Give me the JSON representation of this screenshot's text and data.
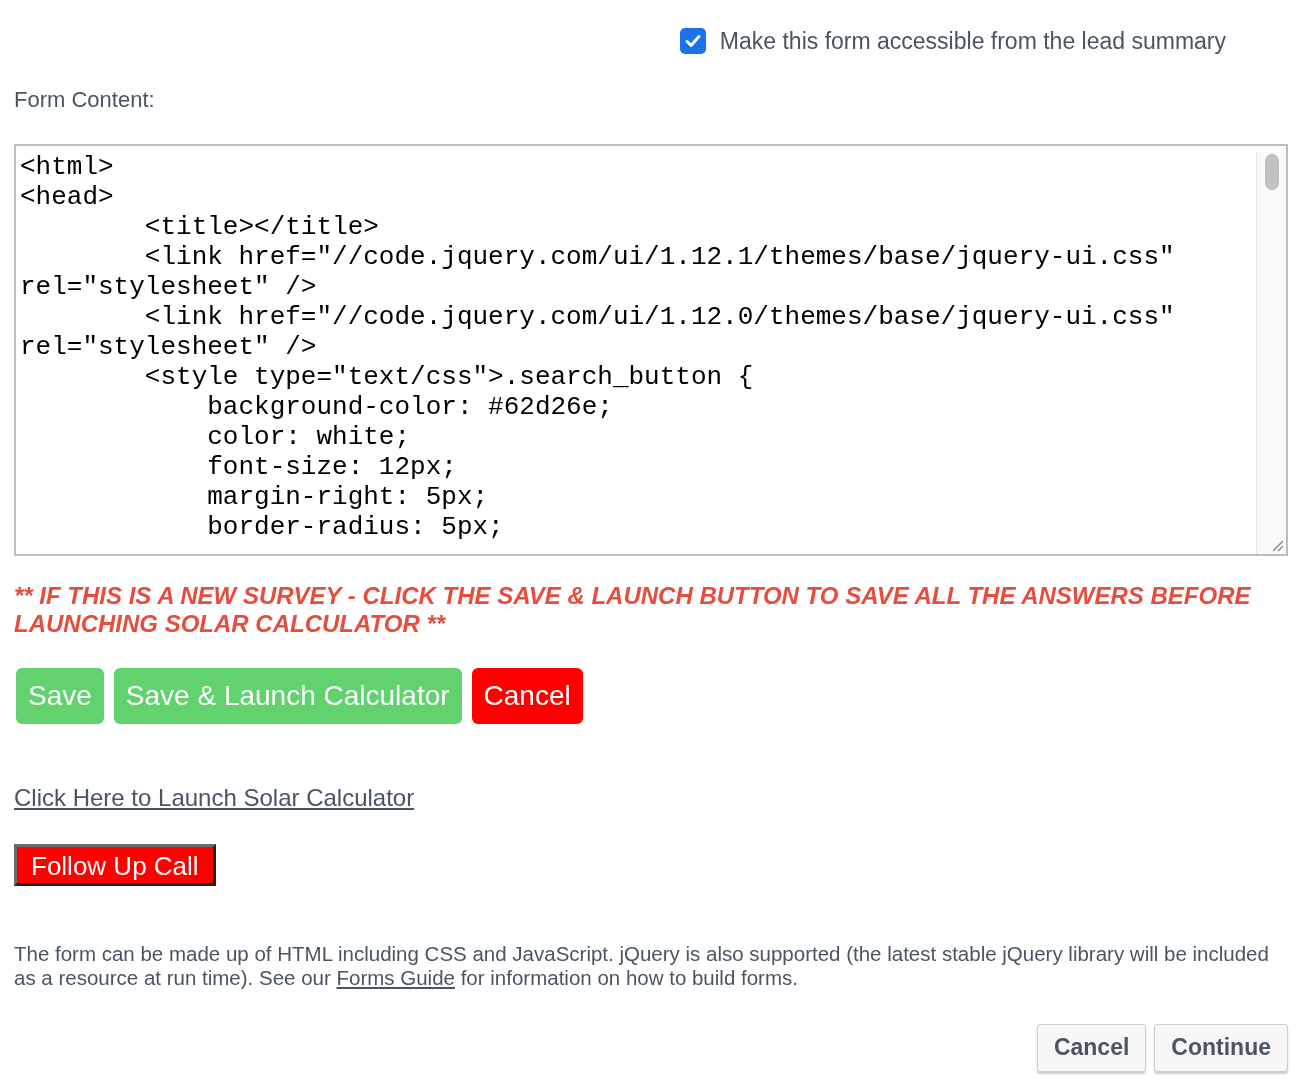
{
  "accessible_option": {
    "label": "Make this form accessible from the lead summary",
    "checked": true
  },
  "form_content": {
    "label": "Form Content:",
    "code_lines": [
      "<html>",
      "<head>",
      "\t<title></title>",
      "\t<link href=\"//code.jquery.com/ui/1.12.1/themes/base/jquery-ui.css\"",
      "rel=\"stylesheet\" />",
      "\t<link href=\"//code.jquery.com/ui/1.12.0/themes/base/jquery-ui.css\"",
      "rel=\"stylesheet\" />",
      "\t<style type=\"text/css\">.search_button {",
      "\t    background-color: #62d26e;",
      "\t    color: white;",
      "\t    font-size: 12px;",
      "\t    margin-right: 5px;",
      "\t    border-radius: 5px;"
    ]
  },
  "warning": "** IF THIS IS A NEW SURVEY - CLICK THE SAVE  & LAUNCH BUTTON TO SAVE ALL THE ANSWERS BEFORE LAUNCHING SOLAR CALCULATOR **",
  "preview_buttons": [
    {
      "label": "Save",
      "kind": "green"
    },
    {
      "label": "Save & Launch Calculator",
      "kind": "green"
    },
    {
      "label": "Cancel",
      "kind": "red"
    }
  ],
  "launch_link": "Click Here to Launch Solar Calculator",
  "follow_up_button": "Follow Up Call",
  "help_text": {
    "before": "The form can be made up of HTML including CSS and JavaScript. jQuery is also supported (the latest stable jQuery library will be included as a resource at run time). See our",
    "link": "Forms Guide",
    "after": "for information on how to build forms."
  },
  "footer_buttons": [
    "Cancel",
    "Continue"
  ]
}
